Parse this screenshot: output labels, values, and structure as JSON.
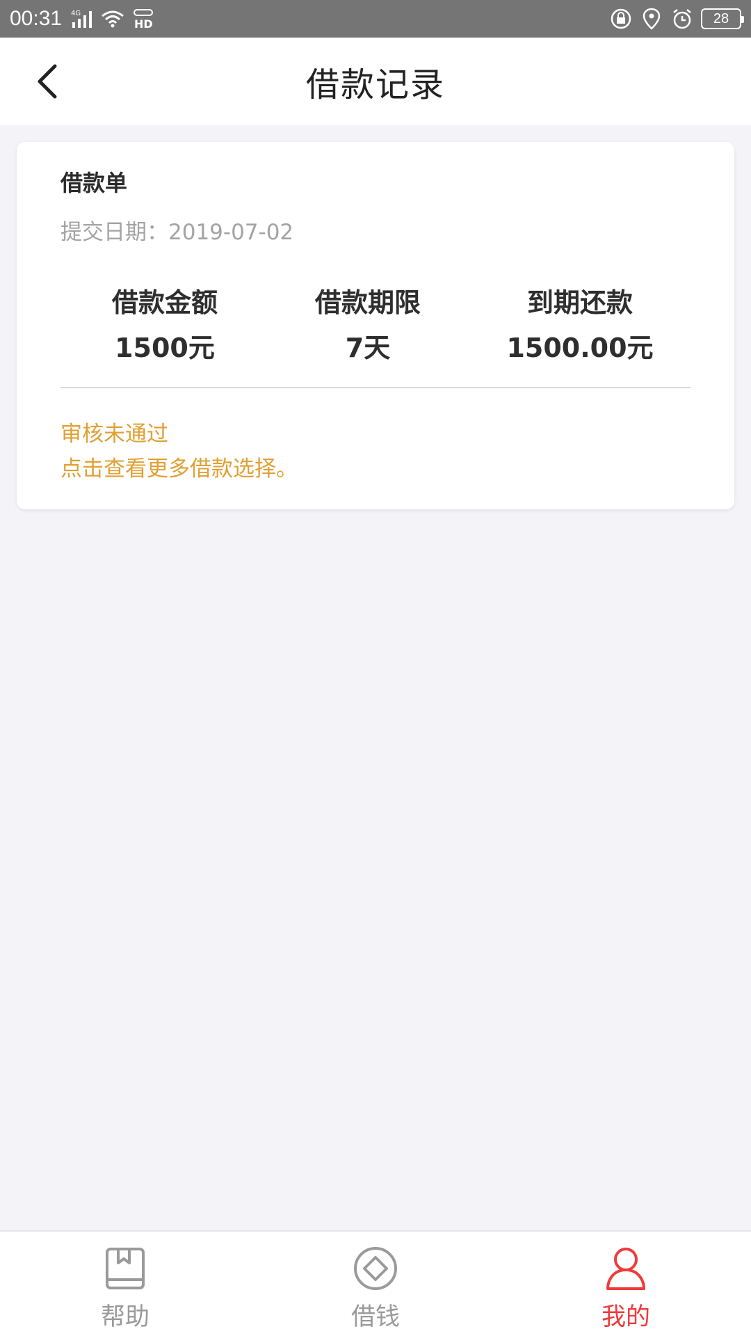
{
  "status_bar": {
    "time": "00:31",
    "network": "4G",
    "hd": "HD",
    "battery": "28",
    "icons": [
      "signal-icon",
      "wifi-icon",
      "hd-icon",
      "lock-icon",
      "location-icon",
      "alarm-icon",
      "battery-icon"
    ]
  },
  "header": {
    "title": "借款记录",
    "back_icon": "chevron-left-icon"
  },
  "card": {
    "title": "借款单",
    "submit_date": "提交日期：2019-07-02",
    "stats": [
      {
        "label": "借款金额",
        "value": "1500元"
      },
      {
        "label": "借款期限",
        "value": "7天"
      },
      {
        "label": "到期还款",
        "value": "1500.00元"
      }
    ],
    "status": "审核未通过",
    "more_link": "点击查看更多借款选择。"
  },
  "bottom_nav": {
    "items": [
      {
        "label": "帮助",
        "icon": "book-icon",
        "active": false
      },
      {
        "label": "借钱",
        "icon": "diamond-icon",
        "active": false
      },
      {
        "label": "我的",
        "icon": "user-icon",
        "active": true
      }
    ]
  },
  "colors": {
    "accent": "#ef3b3b",
    "status": "#e0a034",
    "status_bar_bg": "#757575",
    "page_bg": "#f4f4f8"
  }
}
